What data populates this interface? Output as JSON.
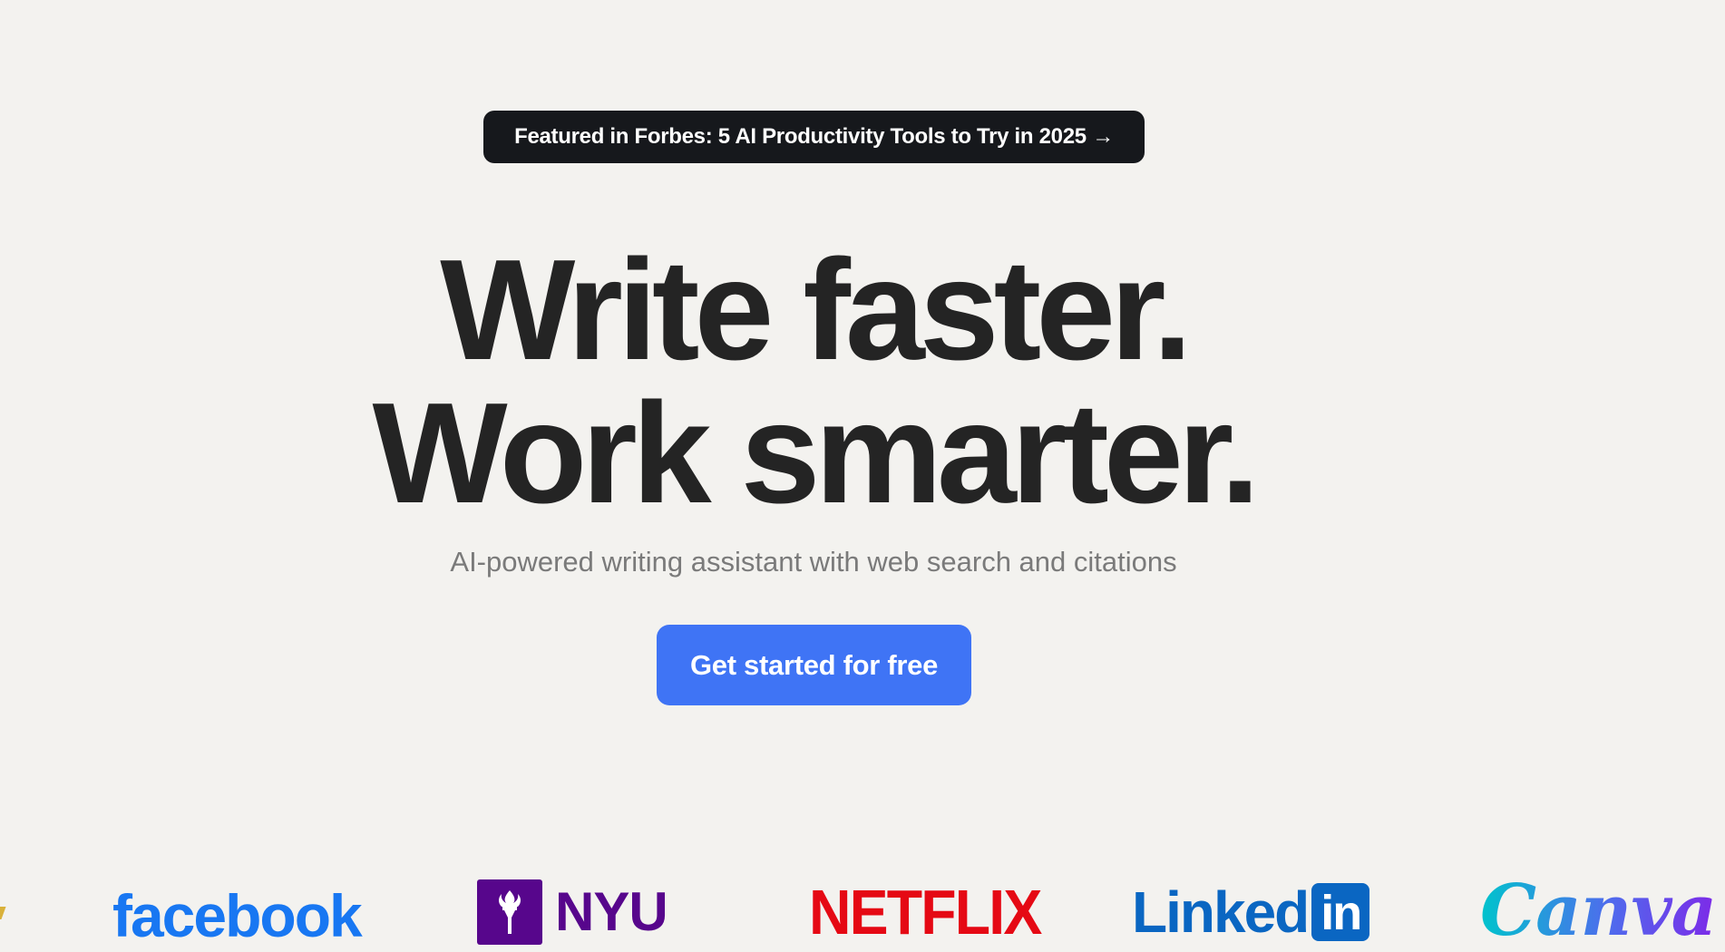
{
  "banner": {
    "text": "Featured in Forbes: 5 AI Productivity Tools to Try in 2025 →"
  },
  "hero": {
    "headline_line1": "Write faster.",
    "headline_line2": "Work smarter.",
    "subtitle": "AI-powered writing assistant with web search and citations",
    "cta_label": "Get started for free"
  },
  "logos": {
    "facebook": "facebook",
    "nyu": "NYU",
    "netflix": "NETFLIX",
    "linkedin_text": "Linked",
    "linkedin_box": "in",
    "canva": "Canva",
    "icons": [
      "nyu-torch-icon"
    ]
  },
  "colors": {
    "background": "#f3f2ef",
    "banner_bg": "#16181c",
    "headline": "#242424",
    "subtitle": "#7a7a7a",
    "cta_bg": "#3f74f5",
    "facebook": "#1877f2",
    "nyu": "#57068c",
    "netflix": "#e50914",
    "linkedin": "#0a66c2"
  }
}
